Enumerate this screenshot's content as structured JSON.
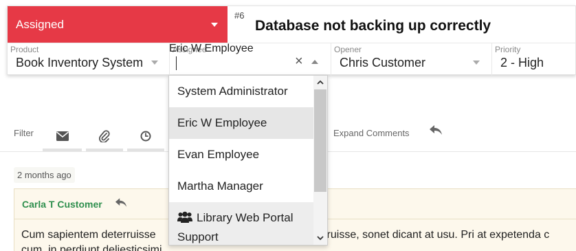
{
  "ticket": {
    "status": "Assigned",
    "number": "#6",
    "title": "Database not backing up correctly"
  },
  "fields": {
    "product": {
      "label": "Product",
      "value": "Book Inventory System"
    },
    "assignee": {
      "label": "Assignee",
      "value": "Eric W Employee"
    },
    "opener": {
      "label": "Opener",
      "value": "Chris Customer"
    },
    "priority": {
      "label": "Priority",
      "value": "2 - High"
    }
  },
  "toolbar": {
    "filter_label": "Filter",
    "expand_comments": "Expand Comments",
    "icons": [
      "envelope-icon",
      "paperclip-icon",
      "clock-icon",
      "reply-icon"
    ]
  },
  "dropdown": {
    "options": [
      "System Administrator",
      "Eric W Employee",
      "Evan Employee",
      "Martha Manager"
    ],
    "selected": "Eric W Employee",
    "group_option": {
      "line1": "Library Web Portal",
      "line2": "Support",
      "icon": "users-icon"
    }
  },
  "comment": {
    "time": "2 months ago",
    "author": "Carla T Customer",
    "body_left": "Cum sapientem deterruisse",
    "body_right": "seruisse, sonet dicant at usu. Pri at expetenda c",
    "body_line2": "cum, in perdiunt deliesticsimi"
  },
  "colors": {
    "status_bg": "#e63946",
    "author_green": "#2f8f4e",
    "comment_bg": "#fdf8ec"
  }
}
